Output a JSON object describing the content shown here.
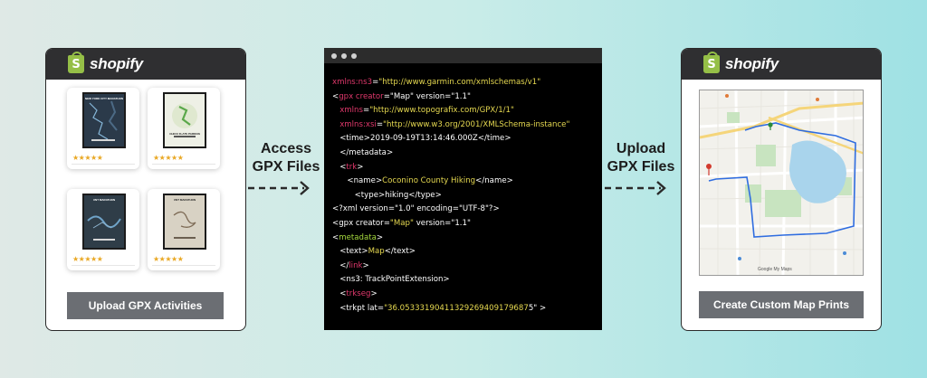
{
  "left_panel": {
    "brand": "shopify",
    "products": [
      {
        "title": "NEW YORK CITY MARATHON",
        "rating": "★★★★★"
      },
      {
        "title": "CHICO FLATS PARDON",
        "rating": "★★★★★"
      },
      {
        "title": "UNT MARATHON",
        "rating": "★★★★★"
      },
      {
        "title": "UNT MARATHON",
        "rating": "★★★★★"
      }
    ],
    "button_label": "Upload GPX Activities"
  },
  "arrow_left": {
    "line1": "Access",
    "line2": "GPX Files"
  },
  "arrow_right": {
    "line1": "Upload",
    "line2": "GPX Files"
  },
  "code_lines": [
    [
      {
        "t": "xmlns:ns3",
        "c": "r"
      },
      {
        "t": "=",
        "c": "w"
      },
      {
        "t": "\"http://www.garmin.com/xmlschemas/v1\"",
        "c": "y"
      }
    ],
    [
      {
        "t": "<",
        "c": "w"
      },
      {
        "t": "gpx creator",
        "c": "r"
      },
      {
        "t": "=\"Map\" version=\"1.1\"",
        "c": "w"
      }
    ],
    [
      {
        "t": "   ",
        "c": "w"
      },
      {
        "t": "xmlns",
        "c": "r"
      },
      {
        "t": "=",
        "c": "w"
      },
      {
        "t": "\"http://www.topografix.com/GPX/1/1\"",
        "c": "y"
      }
    ],
    [
      {
        "t": "   ",
        "c": "w"
      },
      {
        "t": "xmlns:xsi",
        "c": "r"
      },
      {
        "t": "=",
        "c": "w"
      },
      {
        "t": "\"http://www.w3.org/2001/XMLSchema-instance\"",
        "c": "y"
      }
    ],
    [
      {
        "t": "   <time>2019-09-19T13:14:46.000Z</time>",
        "c": "w"
      }
    ],
    [
      {
        "t": "   </metadata>",
        "c": "w"
      }
    ],
    [
      {
        "t": "   <",
        "c": "w"
      },
      {
        "t": "trk",
        "c": "r"
      },
      {
        "t": ">",
        "c": "w"
      }
    ],
    [
      {
        "t": "      <name>",
        "c": "w"
      },
      {
        "t": "Coconino County Hiking",
        "c": "y"
      },
      {
        "t": "</name>",
        "c": "w"
      }
    ],
    [
      {
        "t": "         <type>hiking</type>",
        "c": "w"
      }
    ],
    [
      {
        "t": "<?xml version=\"1.0\" encoding=\"UTF-8\"?>",
        "c": "w"
      }
    ],
    [
      {
        "t": "<gpx creator=",
        "c": "w"
      },
      {
        "t": "\"Map\"",
        "c": "y"
      },
      {
        "t": " version=\"1.1\"",
        "c": "w"
      }
    ],
    [
      {
        "t": "<",
        "c": "w"
      },
      {
        "t": "metadata",
        "c": "g"
      },
      {
        "t": ">",
        "c": "w"
      }
    ],
    [
      {
        "t": "   <text>",
        "c": "w"
      },
      {
        "t": "Map",
        "c": "y"
      },
      {
        "t": "</text>",
        "c": "w"
      }
    ],
    [
      {
        "t": "   </",
        "c": "w"
      },
      {
        "t": "link",
        "c": "r"
      },
      {
        "t": ">",
        "c": "w"
      }
    ],
    [
      {
        "t": "   <ns3: TrackPointExtension>",
        "c": "w"
      }
    ],
    [
      {
        "t": "   <",
        "c": "w"
      },
      {
        "t": "trkseg",
        "c": "r"
      },
      {
        "t": ">",
        "c": "w"
      }
    ],
    [
      {
        "t": "   <trkpt lat=",
        "c": "w"
      },
      {
        "t": "\"36.05333190411329269409179687",
        "c": "y"
      },
      {
        "t": "5\" >",
        "c": "w"
      }
    ]
  ],
  "right_panel": {
    "brand": "shopify",
    "map_attribution": "Google  My Maps",
    "button_label": "Create Custom Map Prints"
  }
}
